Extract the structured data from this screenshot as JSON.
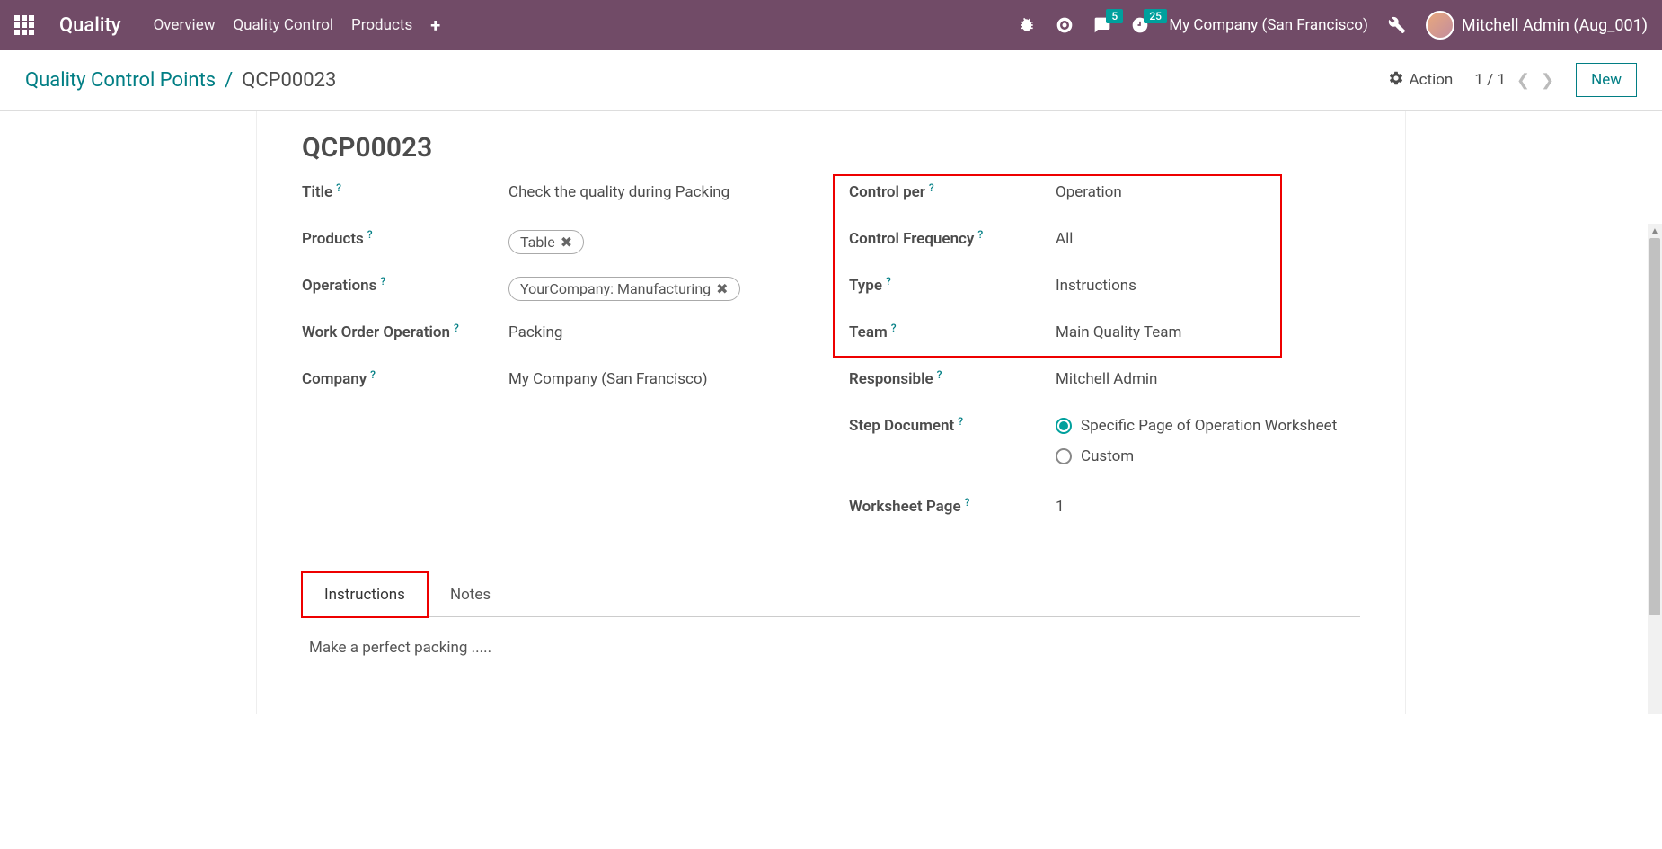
{
  "navbar": {
    "app_title": "Quality",
    "links": [
      "Overview",
      "Quality Control",
      "Products"
    ],
    "messages_count": "5",
    "activities_count": "25",
    "company": "My Company (San Francisco)",
    "user_name": "Mitchell Admin (Aug_001)"
  },
  "control_panel": {
    "breadcrumb_root": "Quality Control Points",
    "breadcrumb_current": "QCP00023",
    "action_label": "Action",
    "pager": "1 / 1",
    "new_label": "New"
  },
  "record": {
    "name": "QCP00023",
    "left": {
      "title_label": "Title",
      "title_value": "Check the quality during Packing",
      "products_label": "Products",
      "products_tag": "Table",
      "operations_label": "Operations",
      "operations_tag": "YourCompany: Manufacturing",
      "work_order_op_label": "Work Order Operation",
      "work_order_op_value": "Packing",
      "company_label": "Company",
      "company_value": "My Company (San Francisco)"
    },
    "right": {
      "control_per_label": "Control per",
      "control_per_value": "Operation",
      "control_freq_label": "Control Frequency",
      "control_freq_value": "All",
      "type_label": "Type",
      "type_value": "Instructions",
      "team_label": "Team",
      "team_value": "Main Quality Team",
      "responsible_label": "Responsible",
      "responsible_value": "Mitchell Admin",
      "step_doc_label": "Step Document",
      "step_doc_opt1": "Specific Page of Operation Worksheet",
      "step_doc_opt2": "Custom",
      "worksheet_page_label": "Worksheet Page",
      "worksheet_page_value": "1"
    }
  },
  "tabs": {
    "instructions": "Instructions",
    "notes": "Notes",
    "instructions_content": "Make a perfect packing ....."
  }
}
